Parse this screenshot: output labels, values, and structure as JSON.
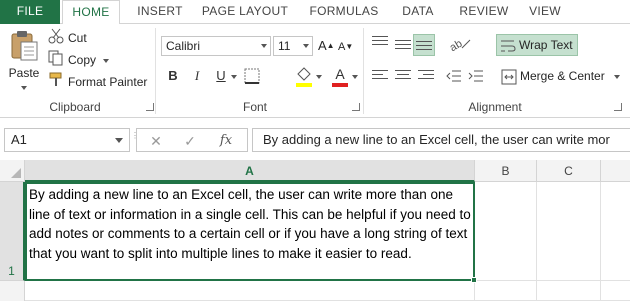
{
  "ribbon_tabs": {
    "file": "FILE",
    "home": "HOME",
    "insert": "INSERT",
    "page_layout": "PAGE LAYOUT",
    "formulas": "FORMULAS",
    "data": "DATA",
    "review": "REVIEW",
    "view": "VIEW"
  },
  "clipboard": {
    "paste": "Paste",
    "cut": "Cut",
    "copy": "Copy",
    "format_painter": "Format Painter",
    "label": "Clipboard"
  },
  "font": {
    "name": "Calibri",
    "size": "11",
    "bold": "B",
    "italic": "I",
    "underline": "U",
    "font_color_glyph": "A",
    "label": "Font"
  },
  "alignment": {
    "wrap_text": "Wrap Text",
    "merge_center": "Merge & Center",
    "label": "Alignment"
  },
  "formula_bar": {
    "name_box": "A1",
    "cancel": "✕",
    "enter": "✓",
    "fx": "fx",
    "content": "By adding a new line to an Excel cell, the user can write mor"
  },
  "grid": {
    "columns": [
      "A",
      "B",
      "C"
    ],
    "rows": [
      "1"
    ],
    "cell_a1": "By adding a new line to an Excel cell, the user can write more than one line of text or information in a single cell. This can be helpful if you need to add notes or comments to a certain cell or if you have a long string of text that you want to split into multiple lines to make it easier to read."
  },
  "colors": {
    "accent": "#217346",
    "highlight": "#c5e0cf",
    "font_color": "#e02020",
    "fill_color": "#ffff00"
  }
}
